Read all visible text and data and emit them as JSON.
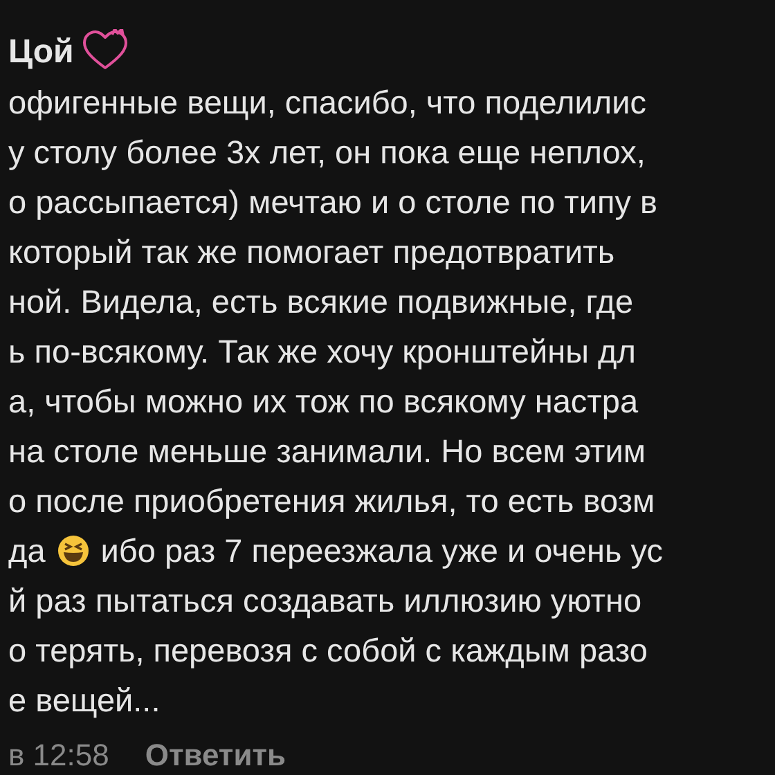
{
  "comment": {
    "author": "Цой",
    "lines": [
      {
        "kind": "text",
        "text": "офигенные вещи, спасибо, что поделилис"
      },
      {
        "kind": "text",
        "text": "у столу более 3х лет, он пока еще неплох,"
      },
      {
        "kind": "text",
        "text": "о рассыпается) мечтаю и о столе по типу в"
      },
      {
        "kind": "text",
        "text": "который так же помогает предотвратить"
      },
      {
        "kind": "text",
        "text": "ной. Видела, есть всякие подвижные, где"
      },
      {
        "kind": "text",
        "text": "ь по-всякому. Так же хочу кронштейны дл"
      },
      {
        "kind": "text",
        "text": "а, чтобы можно их тож по всякому настра"
      },
      {
        "kind": "text",
        "text": "на столе меньше занимали. Но всем этим"
      },
      {
        "kind": "text",
        "text": "о после приобретения жилья, то есть возм"
      },
      {
        "kind": "emoji",
        "before": "да",
        "after": "ибо раз 7 переезжала уже и очень ус"
      },
      {
        "kind": "text",
        "text": "й раз пытаться создавать иллюзию уютно"
      },
      {
        "kind": "text",
        "text": "о терять, перевозя с собой с каждым разо"
      },
      {
        "kind": "text",
        "text": "е вещей..."
      }
    ],
    "time": "в 12:58",
    "reply": "Ответить"
  }
}
